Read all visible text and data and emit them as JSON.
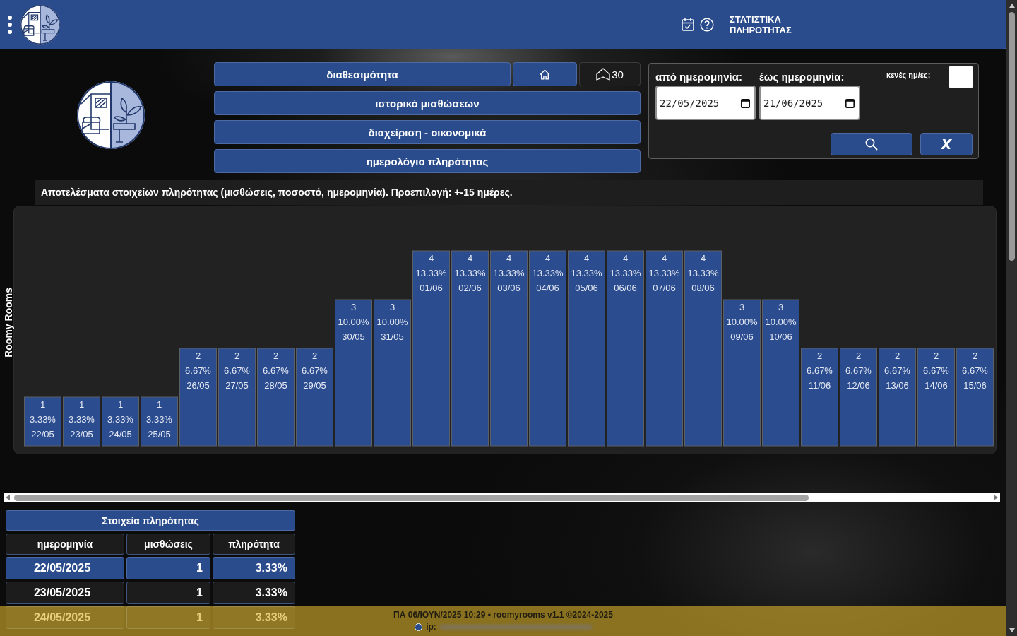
{
  "header": {
    "title": "ΣΤΑΤΙΣΤΙΚΑ ΠΛΗΡΟΤΗΤΑΣ"
  },
  "nav": {
    "rows": [
      {
        "buttons": [
          {
            "kind": "link",
            "label": "διαθεσιμότητα"
          },
          {
            "kind": "home"
          },
          {
            "kind": "counter",
            "label": "30"
          }
        ]
      },
      {
        "buttons": [
          {
            "kind": "link",
            "label": "ιστορικό μισθώσεων"
          }
        ]
      },
      {
        "buttons": [
          {
            "kind": "link",
            "label": "διαχείριση - οικονομικά"
          }
        ]
      },
      {
        "buttons": [
          {
            "kind": "link",
            "label": "ημερολόγιο πληρότητας"
          }
        ]
      }
    ]
  },
  "filter": {
    "from": {
      "label": "από ημερομηνία:",
      "value": "22/05/2025"
    },
    "to": {
      "label": "έως ημερομηνία:",
      "value": "21/06/2025"
    },
    "empty_days": {
      "label": "κενές ημ/ες:",
      "checked": false
    },
    "clear_label": "X"
  },
  "caption": "Αποτελέσματα στοιχείων πληρότητας (μισθώσεις, ποσοστό, ημερομηνία). Προεπιλογή: +-15 ημέρες.",
  "chart": {
    "chart_data": {
      "type": "bar",
      "ylabel": "Roomy Rooms",
      "categories": [
        "22/05",
        "23/05",
        "24/05",
        "25/05",
        "26/05",
        "27/05",
        "28/05",
        "29/05",
        "30/05",
        "31/05",
        "01/06",
        "02/06",
        "03/06",
        "04/06",
        "05/06",
        "06/06",
        "07/06",
        "08/06",
        "09/06",
        "10/06",
        "11/06",
        "12/06",
        "13/06",
        "14/06",
        "15/06"
      ],
      "values": [
        1,
        1,
        1,
        1,
        2,
        2,
        2,
        2,
        3,
        3,
        4,
        4,
        4,
        4,
        4,
        4,
        4,
        4,
        3,
        3,
        2,
        2,
        2,
        2,
        2
      ],
      "data_labels": true,
      "annotations": [
        "3.33%",
        "3.33%",
        "3.33%",
        "3.33%",
        "6.67%",
        "6.67%",
        "6.67%",
        "6.67%",
        "10.00%",
        "10.00%",
        "13.33%",
        "13.33%",
        "13.33%",
        "13.33%",
        "13.33%",
        "13.33%",
        "13.33%",
        "13.33%",
        "10.00%",
        "10.00%",
        "6.67%",
        "6.67%",
        "6.67%",
        "6.67%",
        "6.67%"
      ]
    }
  },
  "table": {
    "title": "Στοιχεία πληρότητας",
    "columns": [
      "ημερομηνία",
      "μισθώσεις",
      "πληρότητα"
    ],
    "rows": [
      {
        "cells": [
          "22/05/2025",
          "1",
          "3.33%"
        ],
        "selected": true
      },
      {
        "cells": [
          "23/05/2025",
          "1",
          "3.33%"
        ],
        "selected": false
      },
      {
        "cells": [
          "24/05/2025",
          "1",
          "3.33%"
        ],
        "selected": false
      }
    ]
  },
  "footer": {
    "text": "ΠΑ 06/ΙΟΥΝ/2025 10:29 • roomyrooms v1.1 ©2024-2025",
    "ip_label": "ip:"
  }
}
